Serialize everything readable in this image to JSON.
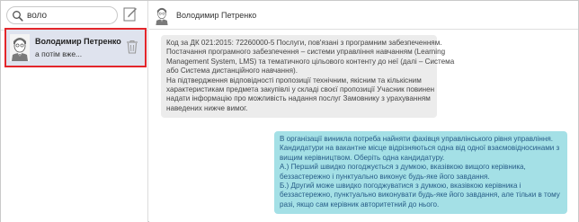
{
  "search": {
    "value": "воло"
  },
  "conversation": {
    "name": "Володимир Петренко",
    "preview": "а потім вже..."
  },
  "chat": {
    "contact_name": "Володимир Петренко",
    "messages": [
      {
        "direction": "incoming",
        "lines": [
          "Код за ДК 021:2015: 72260000-5 Послуги, пов'язані з програмним забезпеченням.",
          "Постачання програмного забезпечення – системи управління навчанням (Learning",
          "Management System, LMS) та тематичного цільового контенту до неї (далі – Система",
          "або Система дистанційного навчання).",
          "На підтвердження відповідності пропозиції технічним, якісним та кількісним",
          "характеристикам предмета закупівлі у складі своєї пропозиції Учасник повинен",
          "надати інформацію про можливість надання послуг Замовнику з урахуванням",
          "наведених нижче вимог."
        ]
      },
      {
        "direction": "outgoing",
        "lines": [
          "В організації виникла потреба найняти фахівця управлінського рівня управління.",
          "Кандидатури на вакантне місце відрізняються одна від одної взаємовідносинами з",
          "вищим керівництвом. Оберіть одна кандидатуру.",
          "А.) Перший швидко погоджується з думкою, вказівкою вищого керівника,",
          "беззастережно і пунктуально виконує будь-яке його завдання.",
          "Б.) Другий може швидко погоджуватися з думкою, вказівкою керівника і",
          "беззастережно, пунктуально виконувати будь-яке його завдання, але тільки в тому",
          "разі, якщо сам керівник авторитетний до нього."
        ]
      }
    ]
  },
  "colors": {
    "selection_border": "#e3262b",
    "selected_bg": "#dfe3ee",
    "incoming_bg": "#ececec",
    "outgoing_bg": "#a4e0e6",
    "outgoing_text": "#275c87"
  },
  "icons": [
    "search-icon",
    "compose-icon",
    "avatar",
    "trash-icon"
  ]
}
